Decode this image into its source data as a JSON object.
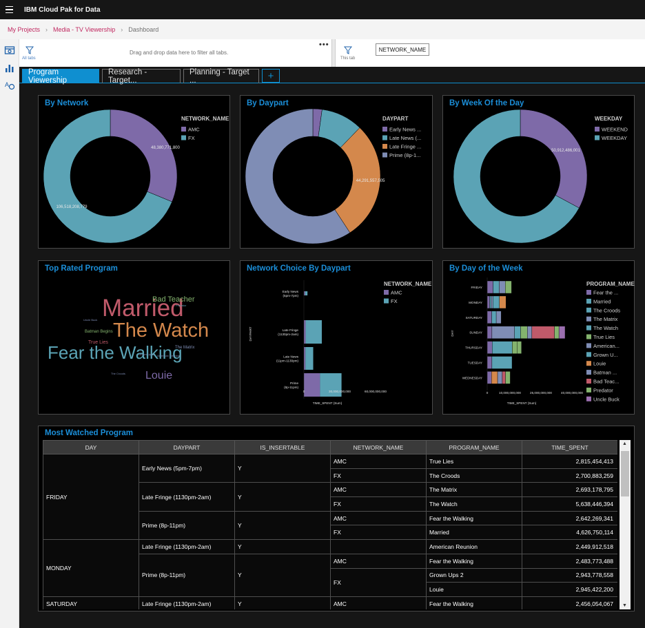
{
  "app": {
    "title": "IBM Cloud Pak for Data"
  },
  "breadcrumb": {
    "items": [
      "My Projects",
      "Media - TV Viewership"
    ],
    "current": "Dashboard"
  },
  "filterbar": {
    "all_tabs_label": "All tabs",
    "drop_hint": "Drag and drop data here to filter all tabs.",
    "more": "•••",
    "this_tab_label": "This tab",
    "chip": "NETWORK_NAME"
  },
  "tabs": [
    {
      "label": "Program Viewership",
      "active": true
    },
    {
      "label": "Research - Target...",
      "active": false
    },
    {
      "label": "Planning - Target ...",
      "active": false
    }
  ],
  "tab_add": "+",
  "colors": {
    "purple": "#7e6aa8",
    "teal": "#5ba3b5",
    "orange": "#d4884c",
    "lavender": "#7f8db5",
    "accent": "#1b8ed8"
  },
  "chart_data": [
    {
      "id": "by_network",
      "type": "pie",
      "title": "By Network",
      "legend_title": "NETWORK_NAME",
      "slices": [
        {
          "label": "AMC",
          "value": 48380771800,
          "display": "48,380,771,800",
          "color": "#7e6aa8"
        },
        {
          "label": "FX",
          "value": 106518208779,
          "display": "106,518,208,779",
          "color": "#5ba3b5"
        }
      ]
    },
    {
      "id": "by_daypart",
      "type": "pie",
      "title": "By Daypart",
      "legend_title": "DAYPART",
      "slices": [
        {
          "label": "Early News ...",
          "value": 3400000000,
          "display": "",
          "color": "#7e6aa8"
        },
        {
          "label": "Late News (...",
          "value": 15570147616,
          "display": "15,570,147,616",
          "color": "#5ba3b5"
        },
        {
          "label": "Late Fringe ...",
          "value": 44291557505,
          "display": "44,291,557,505",
          "color": "#d4884c"
        },
        {
          "label": "Prime (8p-1...",
          "value": 92000000000,
          "display": "",
          "color": "#7f8db5"
        }
      ]
    },
    {
      "id": "by_week",
      "type": "pie",
      "title": "By Week Of the Day",
      "legend_title": "WEEKDAY",
      "slices": [
        {
          "label": "WEEKEND",
          "value": 50912486001,
          "display": "50,912,486,001",
          "color": "#7e6aa8"
        },
        {
          "label": "WEEKDAY",
          "value": 104000000000,
          "display": "",
          "color": "#5ba3b5"
        }
      ]
    },
    {
      "id": "network_choice",
      "type": "bar",
      "title": "Network Choice By Daypart",
      "legend_title": "NETWORK_NAME",
      "categories": [
        "Early News (5pm-7pm)",
        "Late Fringe (1130pm-2am)",
        "Late News (11pm-1130pm)",
        "Prime (8p-11pm)"
      ],
      "series": [
        {
          "name": "AMC",
          "color": "#7e6aa8",
          "values": [
            1000000000,
            1500000000,
            1300000000,
            13500000000
          ]
        },
        {
          "name": "FX",
          "color": "#5ba3b5",
          "values": [
            2000000000,
            13500000000,
            6500000000,
            18000000000
          ]
        }
      ],
      "xticks": [
        "0",
        "30,000,000,000",
        "60,000,000,000"
      ],
      "xmax": 60000000000,
      "ylabel": "DAYPART",
      "xlabel": "TIME_SPENT (Sum)"
    },
    {
      "id": "by_day",
      "type": "bar",
      "title": "By Day of the Week",
      "legend_title": "PROGRAM_NAME",
      "categories": [
        "FRIDAY",
        "MONDAY",
        "SATURDAY",
        "SUNDAY",
        "THURSDAY",
        "TUESDAY",
        "WEDNESDAY"
      ],
      "series": [
        {
          "name": "Fear the ...",
          "color": "#7e6aa8",
          "values": [
            2600000000,
            1100000000,
            2000000000,
            2100000000,
            2200000000,
            2100000000,
            1900000000
          ]
        },
        {
          "name": "Married",
          "color": "#5ba3b5",
          "values": [
            0,
            700000000,
            2000000000,
            0,
            8900000000,
            0,
            0
          ]
        },
        {
          "name": "The Croods",
          "color": "#5ba3b5",
          "values": [
            2700000000,
            0,
            0,
            0,
            0,
            0,
            0
          ]
        },
        {
          "name": "The Matrix",
          "color": "#7f8db5",
          "values": [
            2700000000,
            700000000,
            0,
            10000000000,
            0,
            0,
            0
          ]
        },
        {
          "name": "The Watch",
          "color": "#5ba3b5",
          "values": [
            0,
            0,
            0,
            2700000000,
            0,
            8900000000,
            0
          ]
        },
        {
          "name": "True Lies",
          "color": "#84b36e",
          "values": [
            2800000000,
            0,
            0,
            3000000000,
            2100000000,
            0,
            0
          ]
        },
        {
          "name": "American...",
          "color": "#7f8db5",
          "values": [
            0,
            0,
            0,
            2000000000,
            0,
            0,
            0
          ]
        },
        {
          "name": "Grown U...",
          "color": "#5ba3b5",
          "values": [
            0,
            2900000000,
            0,
            0,
            0,
            0,
            0
          ]
        },
        {
          "name": "Louie",
          "color": "#d4884c",
          "values": [
            0,
            2900000000,
            0,
            0,
            0,
            0,
            2700000000
          ]
        },
        {
          "name": "Batman ...",
          "color": "#7f8db5",
          "values": [
            0,
            0,
            2200000000,
            0,
            0,
            0,
            2100000000
          ]
        },
        {
          "name": "Bad Teac...",
          "color": "#c05a6a",
          "values": [
            0,
            0,
            0,
            10000000000,
            0,
            0,
            1400000000
          ]
        },
        {
          "name": "Predator",
          "color": "#84b36e",
          "values": [
            0,
            0,
            0,
            2000000000,
            2000000000,
            0,
            2100000000
          ]
        },
        {
          "name": "Uncle Buck",
          "color": "#9b6fb0",
          "values": [
            0,
            0,
            0,
            2700000000,
            0,
            0,
            0
          ]
        }
      ],
      "xticks": [
        "0",
        "10,000,000,000",
        "25,000,000,000",
        "40,000,000,000"
      ],
      "ylabel": "DAY",
      "xlabel": "TIME_SPENT (Sum)"
    }
  ],
  "wordcloud": {
    "title": "Top Rated Program",
    "words": [
      {
        "text": "Married",
        "color": "#c05a6a"
      },
      {
        "text": "The Watch",
        "color": "#d4884c"
      },
      {
        "text": "Fear the Walking",
        "color": "#5ba3b5"
      },
      {
        "text": "Louie",
        "color": "#7e6aa8"
      },
      {
        "text": "Bad Teacher",
        "color": "#84b36e"
      },
      {
        "text": "Batman Begins",
        "color": "#84b36e"
      },
      {
        "text": "True Lies",
        "color": "#c05a6a"
      },
      {
        "text": "The Matrix",
        "color": "#7f8db5"
      },
      {
        "text": "Predator",
        "color": "#5ba3b5"
      },
      {
        "text": "Uncle Buck",
        "color": "#7f8db5"
      },
      {
        "text": "Grown Ups 2",
        "color": "#7f8db5"
      },
      {
        "text": "The Croods",
        "color": "#7f8db5"
      },
      {
        "text": "American Reunion",
        "color": "#7f8db5"
      }
    ]
  },
  "table": {
    "title": "Most Watched Program",
    "columns": [
      "DAY",
      "DAYPART",
      "IS_INSERTABLE",
      "NETWORK_NAME",
      "PROGRAM_NAME",
      "TIME_SPENT"
    ],
    "rows": [
      {
        "day": "FRIDAY",
        "daypart": "Early News (5pm-7pm)",
        "ins": "Y",
        "net": "AMC",
        "prog": "True Lies",
        "time": "2,815,454,413"
      },
      {
        "day": "",
        "daypart": "",
        "ins": "",
        "net": "FX",
        "prog": "The Croods",
        "time": "2,700,883,259"
      },
      {
        "day": "",
        "daypart": "Late Fringe (1130pm-2am)",
        "ins": "Y",
        "net": "AMC",
        "prog": "The Matrix",
        "time": "2,693,178,795"
      },
      {
        "day": "",
        "daypart": "",
        "ins": "",
        "net": "FX",
        "prog": "The Watch",
        "time": "5,638,446,394"
      },
      {
        "day": "",
        "daypart": "Prime (8p-11pm)",
        "ins": "Y",
        "net": "AMC",
        "prog": "Fear the Walking",
        "time": "2,642,269,341"
      },
      {
        "day": "",
        "daypart": "",
        "ins": "",
        "net": "FX",
        "prog": "Married",
        "time": "4,626,750,114"
      },
      {
        "day": "MONDAY",
        "daypart": "Late Fringe (1130pm-2am)",
        "ins": "Y",
        "net": "",
        "prog": "American Reunion",
        "time": "2,449,912,518"
      },
      {
        "day": "",
        "daypart": "Prime (8p-11pm)",
        "ins": "Y",
        "net": "AMC",
        "prog": "Fear the Walking",
        "time": "2,483,773,488"
      },
      {
        "day": "",
        "daypart": "",
        "ins": "",
        "net": "FX",
        "prog": "Grown Ups 2",
        "time": "2,943,778,558"
      },
      {
        "day": "",
        "daypart": "",
        "ins": "",
        "net": "",
        "prog": "Louie",
        "time": "2,945,422,200"
      },
      {
        "day": "SATURDAY",
        "daypart": "Late Fringe (1130pm-2am)",
        "ins": "Y",
        "net": "AMC",
        "prog": "Fear the Walking",
        "time": "2,456,054,067"
      }
    ]
  }
}
